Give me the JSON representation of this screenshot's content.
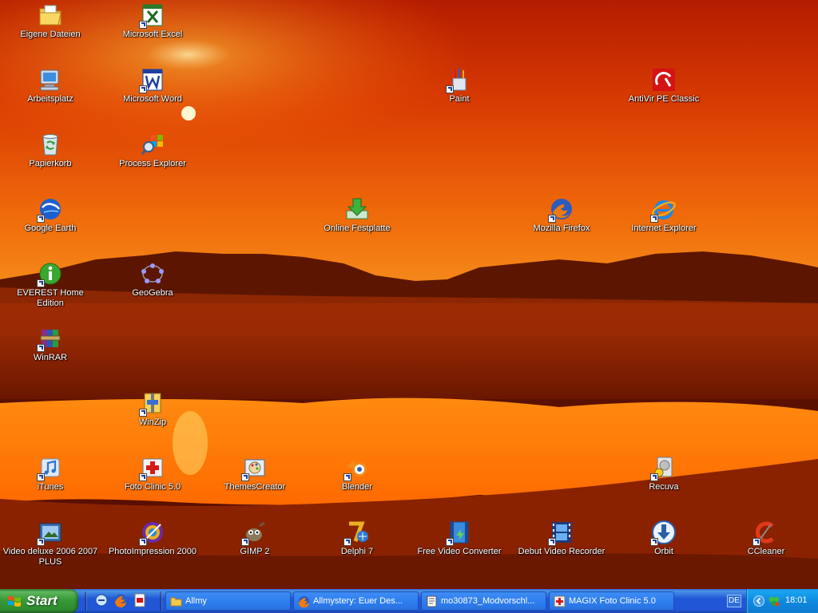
{
  "desktop": {
    "icons": {
      "eigene_dateien": "Eigene Dateien",
      "microsoft_excel": "Microsoft Excel",
      "arbeitsplatz": "Arbeitsplatz",
      "microsoft_word": "Microsoft Word",
      "paint": "Paint",
      "antivir": "AntiVir PE Classic",
      "papierkorb": "Papierkorb",
      "process_explorer": "Process Explorer",
      "google_earth": "Google Earth",
      "online_festplatte": "Online Festplatte",
      "mozilla_firefox": "Mozilla Firefox",
      "internet_explorer": "Internet Explorer",
      "everest": "EVEREST Home Edition",
      "geogebra": "GeoGebra",
      "winrar": "WinRAR",
      "winzip": "WinZip",
      "itunes": "iTunes",
      "foto_clinic": "Foto Clinic 5.0",
      "themes_creator": "ThemesCreator",
      "blender": "Blender",
      "recuva": "Recuva",
      "video_deluxe": "Video deluxe 2006 2007 PLUS",
      "photoimpression": "PhotoImpression 2000",
      "gimp": "GIMP 2",
      "delphi": "Delphi 7",
      "free_video_converter": "Free Video Converter",
      "debut_video_recorder": "Debut Video Recorder",
      "orbit": "Orbit",
      "ccleaner": "CCleaner"
    }
  },
  "taskbar": {
    "start_label": "Start",
    "tasks": {
      "allmy": "Allmy",
      "allmystery": "Allmystery: Euer Des...",
      "mo30873": "mo30873_Modvorschl...",
      "magix": "MAGIX Foto Clinic 5.0"
    },
    "language": "DE",
    "clock": "18:01"
  },
  "colors": {
    "taskbar_blue": "#2157d7",
    "start_green": "#379a37",
    "tray_blue": "#0f8ae0",
    "sky_orange": "#e84a05"
  }
}
